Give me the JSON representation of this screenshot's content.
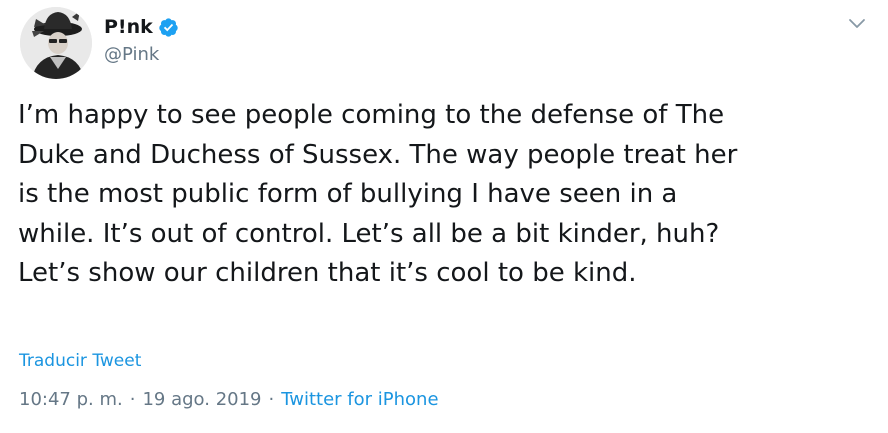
{
  "author": {
    "display_name": "P!nk",
    "handle": "@Pink",
    "verified": true,
    "avatar_icon": "avatar-photo"
  },
  "menu_icon": "chevron-down-icon",
  "tweet": {
    "text": "I’m happy to see people coming to the defense of The\nDuke and Duchess of Sussex. The way people treat her\nis the most public form of bullying I have seen in a\nwhile. It’s out of control. Let’s all be a bit kinder, huh?\nLet’s show our children that it’s cool to be kind.",
    "translate_label": "Traducir Tweet",
    "time": "10:47 p. m.",
    "date": "19 ago. 2019",
    "separator": "·",
    "source": "Twitter for iPhone"
  },
  "colors": {
    "text": "#14171a",
    "secondary": "#657786",
    "link": "#1b95e0",
    "verified": "#1da1f2"
  }
}
